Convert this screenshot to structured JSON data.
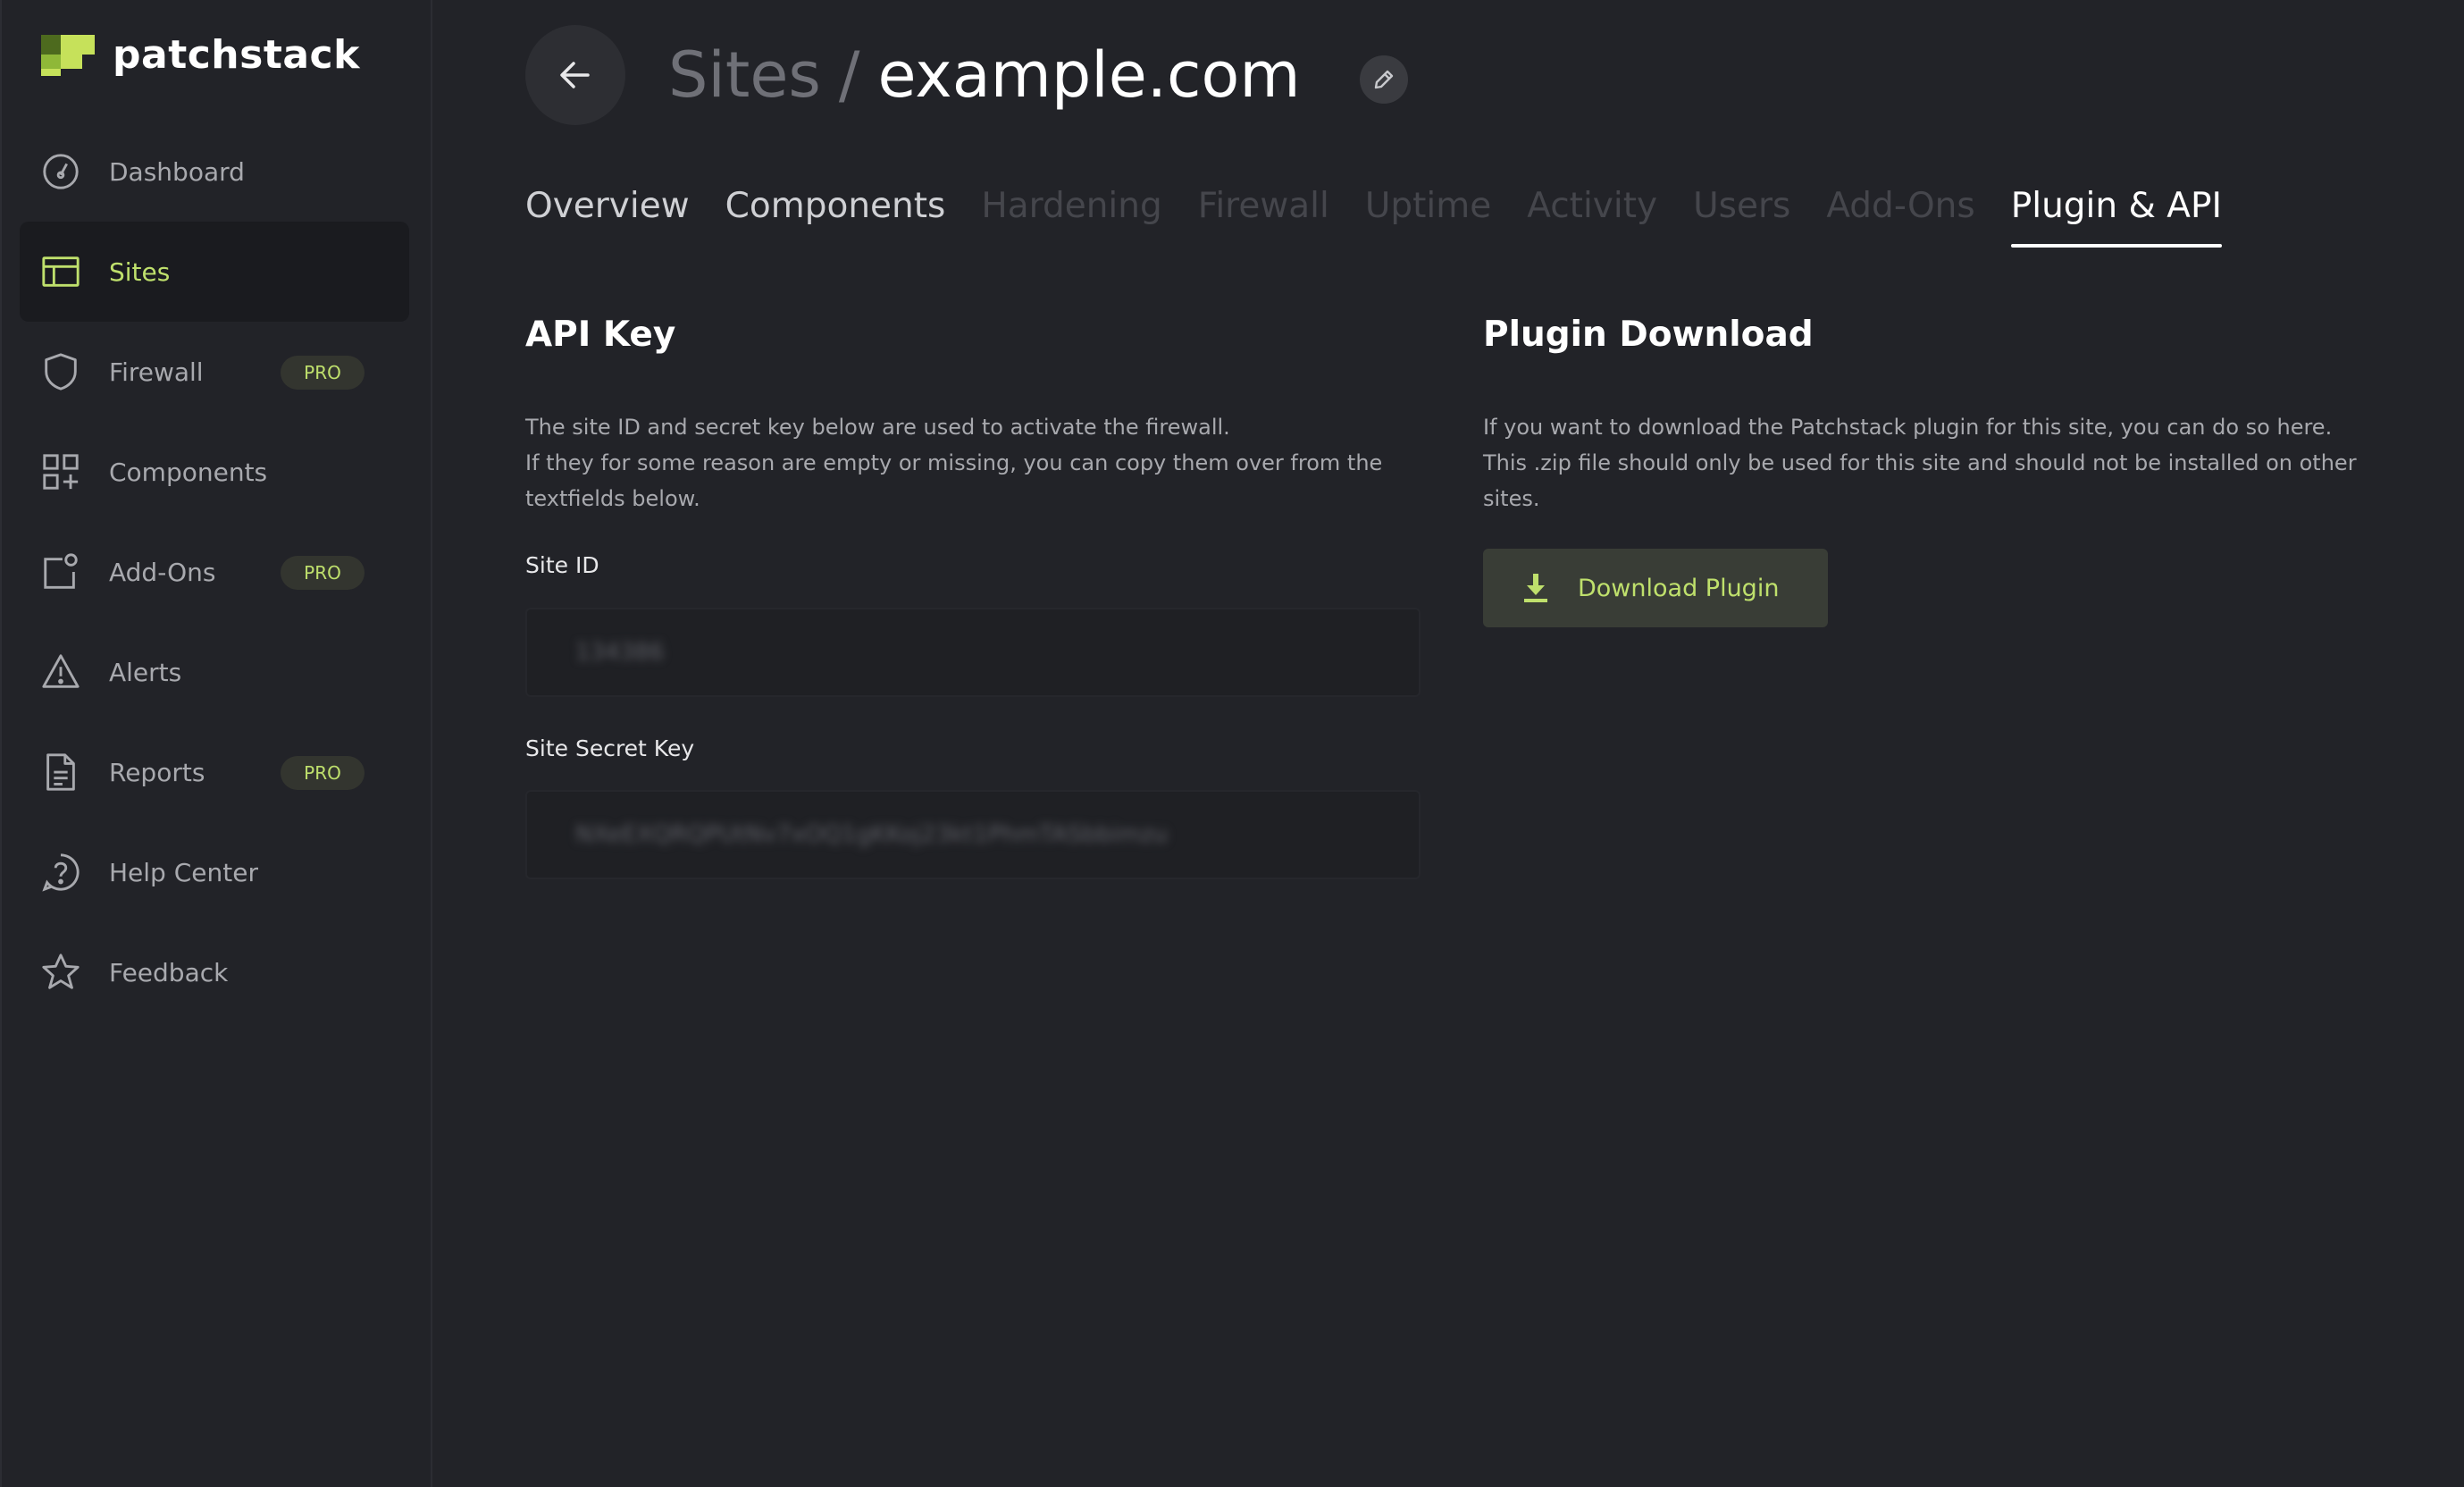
{
  "brand": {
    "name": "patchstack",
    "colors": {
      "accent": "#bfe06c",
      "logo_light": "#c6e15a",
      "logo_mid": "#8fb838",
      "logo_dark": "#4d6a1e"
    }
  },
  "sidebar": {
    "items": [
      {
        "label": "Dashboard",
        "icon": "dashboard-icon",
        "active": false,
        "badge": null
      },
      {
        "label": "Sites",
        "icon": "sites-icon",
        "active": true,
        "badge": null
      },
      {
        "label": "Firewall",
        "icon": "shield-icon",
        "active": false,
        "badge": "PRO"
      },
      {
        "label": "Components",
        "icon": "components-icon",
        "active": false,
        "badge": null
      },
      {
        "label": "Add-Ons",
        "icon": "add-ons-icon",
        "active": false,
        "badge": "PRO"
      },
      {
        "label": "Alerts",
        "icon": "warning-icon",
        "active": false,
        "badge": null
      },
      {
        "label": "Reports",
        "icon": "document-icon",
        "active": false,
        "badge": "PRO"
      },
      {
        "label": "Help Center",
        "icon": "help-icon",
        "active": false,
        "badge": null
      },
      {
        "label": "Feedback",
        "icon": "star-icon",
        "active": false,
        "badge": null
      }
    ]
  },
  "header": {
    "breadcrumb_parent": "Sites",
    "separator": "/",
    "site_name": "example.com"
  },
  "tabs": [
    {
      "label": "Overview",
      "state": "enabled"
    },
    {
      "label": "Components",
      "state": "enabled"
    },
    {
      "label": "Hardening",
      "state": "disabled"
    },
    {
      "label": "Firewall",
      "state": "disabled"
    },
    {
      "label": "Uptime",
      "state": "disabled"
    },
    {
      "label": "Activity",
      "state": "disabled"
    },
    {
      "label": "Users",
      "state": "disabled"
    },
    {
      "label": "Add-Ons",
      "state": "disabled"
    },
    {
      "label": "Plugin & API",
      "state": "active"
    }
  ],
  "api_key": {
    "title": "API Key",
    "description_lines": [
      "The site ID and secret key below are used to activate the firewall.",
      "If they for some reason are empty or missing, you can copy them over from the",
      "textfields below."
    ],
    "site_id_label": "Site ID",
    "site_id_value": "134386",
    "secret_label": "Site Secret Key",
    "secret_value": "NXeEXQRQPUtNv7xOQ1gKKoj23kt1PhmTASbbimzu"
  },
  "plugin_download": {
    "title": "Plugin Download",
    "description_lines": [
      "If you want to download the Patchstack plugin for this site, you can do so here.",
      "This .zip file should only be used for this site and should not be installed on other",
      "sites."
    ],
    "button_label": "Download Plugin"
  }
}
